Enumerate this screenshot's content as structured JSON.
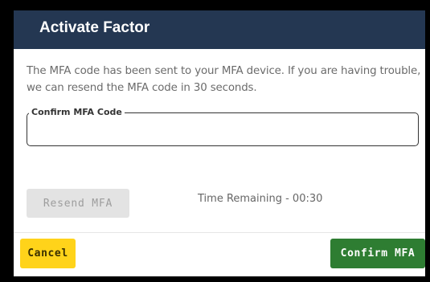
{
  "dialog": {
    "title": "Activate Factor",
    "message": "The MFA code has been sent to your MFA device. If you are having trouble, we can resend the MFA code in 30 seconds.",
    "mfa_field": {
      "label": "Confirm MFA Code",
      "value": "",
      "placeholder": ""
    },
    "resend_label": "Resend MFA",
    "time_remaining": "Time Remaining - 00:30",
    "cancel_label": "Cancel",
    "confirm_label": "Confirm MFA"
  },
  "colors": {
    "header_bg": "#243752",
    "cancel_bg": "#ffd31a",
    "confirm_bg": "#2e7d32",
    "resend_disabled_bg": "#e3e3e3"
  }
}
